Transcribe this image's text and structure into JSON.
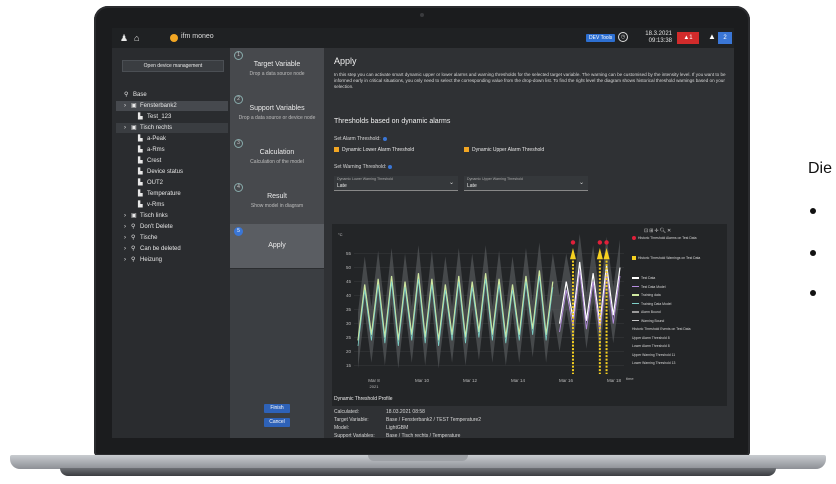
{
  "side": {
    "heading": "Die",
    "bullets": 3
  },
  "topbar": {
    "brand": "ifm moneo",
    "dev_tools": "DEV Tools",
    "date": "18.3.2021",
    "time": "09:13:38",
    "alarm_count": "1",
    "info_count": "2"
  },
  "tree": {
    "open_button": "Open device management",
    "items": [
      {
        "label": "Base",
        "icon": "network-icon"
      },
      {
        "label": "Fensterbank2",
        "icon": "device-icon"
      },
      {
        "label": "Test_123",
        "icon": "sensor-icon"
      },
      {
        "label": "Tisch rechts",
        "icon": "device-icon"
      },
      {
        "label": "a-Peak",
        "icon": "sensor-icon"
      },
      {
        "label": "a-Rms",
        "icon": "sensor-icon"
      },
      {
        "label": "Crest",
        "icon": "sensor-icon"
      },
      {
        "label": "Device status",
        "icon": "sensor-icon"
      },
      {
        "label": "OUT2",
        "icon": "sensor-icon"
      },
      {
        "label": "Temperature",
        "icon": "sensor-icon"
      },
      {
        "label": "v-Rms",
        "icon": "sensor-icon"
      },
      {
        "label": "Tisch links",
        "icon": "device-icon"
      },
      {
        "label": "Don't Delete",
        "icon": "network-icon"
      },
      {
        "label": "Tische",
        "icon": "network-icon"
      },
      {
        "label": "Can be deleted",
        "icon": "network-icon"
      },
      {
        "label": "Heizung",
        "icon": "network-icon"
      }
    ]
  },
  "wizard": {
    "steps": [
      {
        "num": "1",
        "title": "Target Variable",
        "sub": "Drop a data source node"
      },
      {
        "num": "2",
        "title": "Support Variables",
        "sub": "Drop a data source or device node"
      },
      {
        "num": "3",
        "title": "Calculation",
        "sub": "Calculation of the model"
      },
      {
        "num": "4",
        "title": "Result",
        "sub": "Show model in diagram"
      },
      {
        "num": "5",
        "title": "Apply",
        "sub": ""
      }
    ],
    "finish": "Finish",
    "cancel": "Cancel"
  },
  "main": {
    "title": "Apply",
    "intro": "In this step you can activate smart dynamic upper or lower alarms and warning thresholds for the selected target variable. The warning can be customised by the intensity level. If you want to be informed early in critical situations, you only need to select the corresponding value from the drop-down list. To find the right level the diagram shows historical threshold warnings based on your selection.",
    "thresholds_heading": "Thresholds based on dynamic alarms",
    "set_alarm_label": "Set Alarm Threshold:",
    "lower_alarm": "Dynamic Lower Alarm Threshold",
    "upper_alarm": "Dynamic Upper Alarm Threshold",
    "set_warning_label": "Set Warning Threshold:",
    "lower_warning_caption": "Dynamic Lower Warning Threshold",
    "lower_warning_value": "Late",
    "upper_warning_caption": "Dynamic Upper Warning Threshold",
    "upper_warning_value": "Late"
  },
  "chart_data": {
    "type": "line",
    "ylabel": "°C",
    "xlabel": "time",
    "ylim": [
      12,
      62
    ],
    "yticks": [
      15,
      20,
      25,
      30,
      35,
      40,
      45,
      50,
      55
    ],
    "xticks": [
      "Mar 8\n2021",
      "Mar 10",
      "Mar 12",
      "Mar 14",
      "Mar 16",
      "Mar 18"
    ],
    "legend": [
      {
        "name": "Historic Threshold Alarms on Test Data",
        "color": "#e0203a"
      },
      {
        "name": "Historic Threshold Warnings on Test Data",
        "color": "#f5d020"
      },
      {
        "name": "Test Data",
        "color": "#ffffff"
      },
      {
        "name": "Test Data Model",
        "color": "#b58ee0"
      },
      {
        "name": "Training data",
        "color": "#cfe8a0"
      },
      {
        "name": "Training Data Model",
        "color": "#7ed0c8"
      },
      {
        "name": "Alarm Bound",
        "color": "#9a9a9a"
      },
      {
        "name": "Warning Bound",
        "color": "#c8c8c8"
      },
      {
        "name": "Historic Threshold Events on Test Data",
        "color": ""
      },
      {
        "name": "Upper Alarm Threshold 8",
        "color": ""
      },
      {
        "name": "Lower Alarm Threshold 8",
        "color": ""
      },
      {
        "name": "Upper Warning Threshold 11",
        "color": ""
      },
      {
        "name": "Lower Warning Threshold 13",
        "color": ""
      }
    ],
    "series": [
      {
        "name": "Training data",
        "values": [
          24,
          44,
          26,
          46,
          25,
          47,
          24,
          45,
          26,
          48,
          25,
          46,
          24,
          44,
          26,
          47,
          25,
          45,
          27,
          48,
          26,
          46,
          25,
          44,
          26,
          47,
          28,
          49,
          26,
          45
        ]
      },
      {
        "name": "Test Data",
        "values": [
          30,
          45,
          32,
          52,
          31,
          48,
          30,
          51,
          33,
          50
        ]
      }
    ]
  },
  "profile": {
    "heading": "Dynamic Threshold Profile",
    "rows": [
      {
        "label": "Calculated:",
        "value": "18.03.2021 08:58"
      },
      {
        "label": "Target Variable:",
        "value": "Base / Fensterbank2 / TEST Temperature2"
      },
      {
        "label": "Model:",
        "value": "LightGBM"
      },
      {
        "label": "Support Variables:",
        "value": "Base / Tisch rechts / Temperature"
      }
    ]
  }
}
